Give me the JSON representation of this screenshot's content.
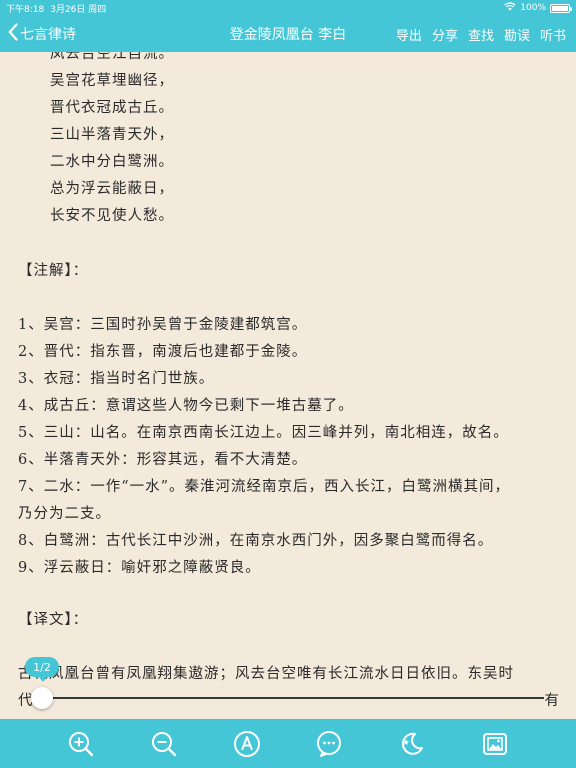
{
  "status_bar": {
    "time": "下午8:18",
    "date": "3月26日 周四",
    "battery": "100%"
  },
  "nav": {
    "back_label": "七言律诗",
    "title": "登金陵凤凰台 李白",
    "actions": [
      "导出",
      "分享",
      "查找",
      "勘误",
      "听书"
    ]
  },
  "poem_lines": [
    "凤去台空江自流。",
    "吴宫花草埋幽径，",
    "晋代衣冠成古丘。",
    "三山半落青天外，",
    "二水中分白鹭洲。",
    "总为浮云能蔽日，",
    "长安不见使人愁。"
  ],
  "notes_heading": "【注解】：",
  "notes": [
    "1、吴宫：三国时孙吴曾于金陵建都筑宫。",
    "2、晋代：指东晋，南渡后也建都于金陵。",
    "3、衣冠：指当时名门世族。",
    "4、成古丘：意谓这些人物今已剩下一堆古墓了。",
    "5、三山：山名。在南京西南长江边上。因三峰并列，南北相连，故名。",
    "6、半落青天外：形容其远，看不大清楚。",
    "7、二水：一作“一水”。秦淮河流经南京后，西入长江，白鹭洲横其间，",
    "乃分为二支。",
    "8、白鹭洲：古代长江中沙洲，在南京水西门外，因多聚白鹭而得名。",
    "9、浮云蔽日：喻奸邪之障蔽贤良。"
  ],
  "translation_heading": "【译文】：",
  "translation_lines": [
    "古代凤凰台曾有凤凰翔集遨游；风去台空唯有长江流水日日依旧。东吴时",
    "代",
    "有"
  ],
  "slider": {
    "page_label": "1/2",
    "value": 0.0
  },
  "toolbar": {
    "icons": [
      "zoom-in-icon",
      "zoom-out-icon",
      "font-icon",
      "comment-icon",
      "night-mode-icon",
      "image-icon"
    ]
  },
  "colors": {
    "accent": "#45c6d6",
    "paper": "#f4eadb"
  }
}
